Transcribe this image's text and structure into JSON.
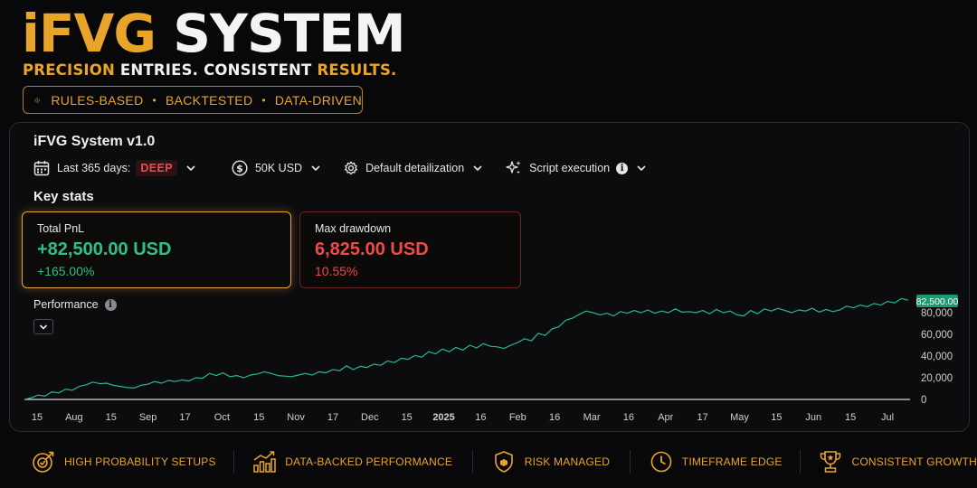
{
  "hero": {
    "title_part1": "iFVG",
    "title_part2": " SYSTEM",
    "tagline": {
      "p1": "PRECISION",
      "p2": " ENTRIES. CONSISTENT ",
      "p3": "RESULTS."
    },
    "pill": {
      "item1": "RULES-BASED",
      "item2": "BACKTESTED",
      "item3": "DATA-DRIVEN",
      "separator": "•"
    }
  },
  "panel": {
    "title": "iFVG System v1.0",
    "filters": {
      "period_label": "Last 365 days:",
      "period_badge": "DEEP",
      "account": "50K USD",
      "detail": "Default detailization",
      "script": "Script execution",
      "info_glyph": "i"
    },
    "key_stats_heading": "Key stats",
    "cards": {
      "pnl": {
        "label": "Total PnL",
        "value": "+82,500.00 USD",
        "percent": "+165.00%"
      },
      "drawdown": {
        "label": "Max drawdown",
        "value": "6,825.00 USD",
        "percent": "10.55%"
      }
    },
    "performance_label": "Performance",
    "icons": {
      "calendar": "calendar-icon",
      "dollar": "dollar-icon",
      "gear": "gear-icon",
      "sparkle": "sparkle-icon",
      "chevron": "chevron-down-icon",
      "info": "info-icon"
    }
  },
  "colors": {
    "gold": "#e9a52a",
    "green": "#2fbf8a",
    "red": "#ee4a4a",
    "line": "#25b98c"
  },
  "chart_data": {
    "type": "line",
    "x_tick_labels": [
      "15",
      "Aug",
      "15",
      "Sep",
      "17",
      "Oct",
      "15",
      "Nov",
      "17",
      "Dec",
      "15",
      "2025",
      "16",
      "Feb",
      "16",
      "Mar",
      "16",
      "Apr",
      "17",
      "May",
      "15",
      "Jun",
      "15",
      "Jul"
    ],
    "y_ticks": [
      0,
      20000,
      40000,
      60000,
      80000
    ],
    "y_tick_labels": [
      "0",
      "20,000",
      "40,000",
      "60,000",
      "80,000"
    ],
    "ylim": [
      0,
      95000
    ],
    "last_value_label": "82,500.00",
    "series": [
      {
        "values": [
          0,
          1500,
          4000,
          3000,
          7000,
          6000,
          9500,
          8500,
          12000,
          13500,
          16000,
          14500,
          15000,
          13000,
          12000,
          11000,
          10500,
          13000,
          14000,
          16500,
          15000,
          17500,
          16500,
          18000,
          17000,
          20000,
          19500,
          24000,
          22000,
          24500,
          21000,
          22000,
          20000,
          22500,
          23500,
          25500,
          24000,
          22000,
          21500,
          21000,
          22500,
          24000,
          22500,
          25500,
          24500,
          27500,
          26500,
          31000,
          27500,
          30500,
          29500,
          32500,
          31500,
          35500,
          34000,
          38000,
          37000,
          40500,
          39000,
          44000,
          42000,
          46500,
          44000,
          48000,
          45500,
          50000,
          47500,
          51500,
          49000,
          48500,
          47000,
          50000,
          52500,
          56000,
          54000,
          61000,
          59000,
          65000,
          67000,
          73000,
          75000,
          78500,
          81500,
          80000,
          78000,
          79500,
          77000,
          81000,
          79500,
          82000,
          80000,
          82500,
          79500,
          81500,
          80000,
          83500,
          80500,
          81000,
          80000,
          82000,
          79000,
          83000,
          80000,
          81500,
          78000,
          77000,
          82000,
          79000,
          83500,
          81500,
          84000,
          82000,
          80000,
          82500,
          81500,
          84000,
          80500,
          83000,
          81000,
          82500,
          86000,
          84500,
          87000,
          85500,
          88500,
          87000,
          90500,
          89000,
          93000,
          91500
        ]
      }
    ]
  },
  "features": [
    {
      "label": "HIGH PROBABILITY SETUPS",
      "icon": "target-check-icon"
    },
    {
      "label": "DATA-BACKED PERFORMANCE",
      "icon": "bar-chart-icon"
    },
    {
      "label": "RISK MANAGED",
      "icon": "shield-icon"
    },
    {
      "label": "TIMEFRAME EDGE",
      "icon": "clock-icon"
    },
    {
      "label": "CONSISTENT GROWTH",
      "icon": "trophy-icon"
    }
  ]
}
